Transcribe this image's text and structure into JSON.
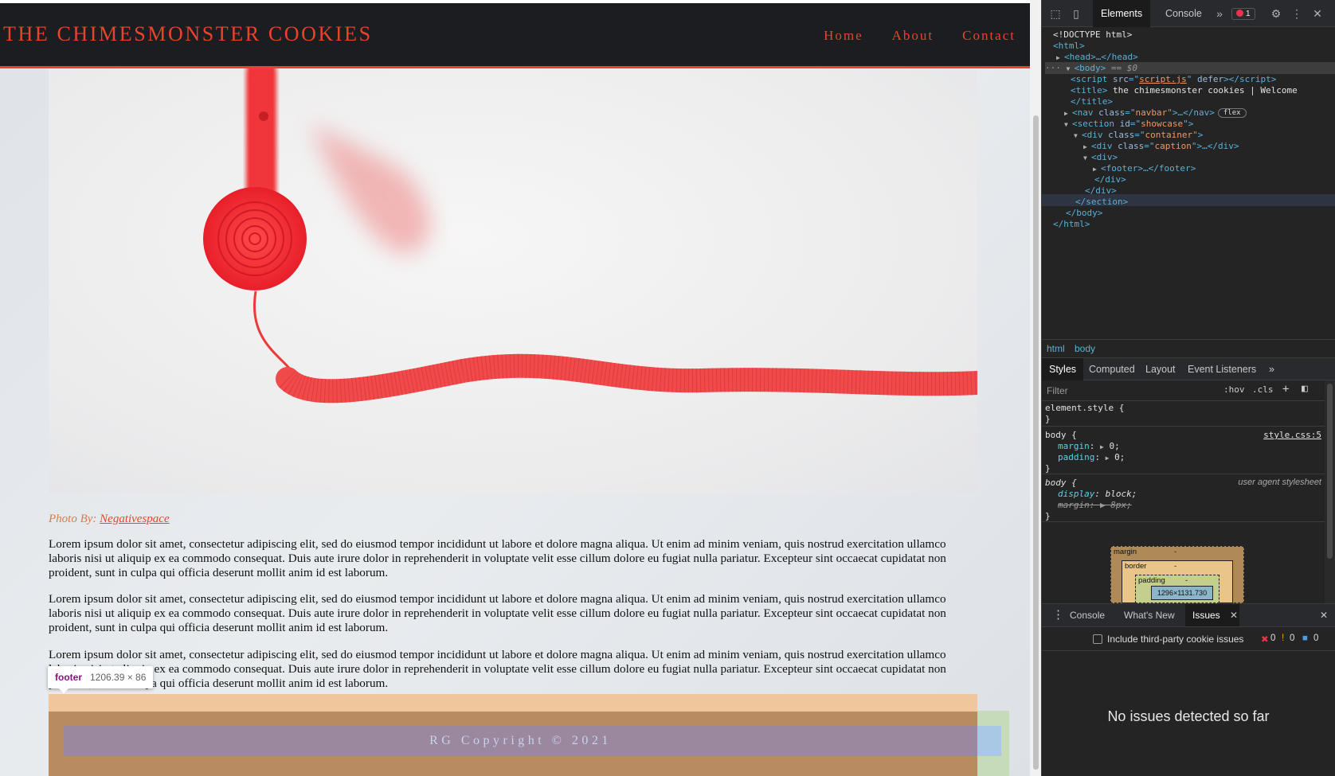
{
  "page": {
    "brand": "THE CHIMESMONSTER COOKIES",
    "nav": [
      "Home",
      "About",
      "Contact"
    ],
    "photo_caption_prefix": "Photo By: ",
    "photo_credit": "Negativespace",
    "paragraphs": [
      "Lorem ipsum dolor sit amet, consectetur adipiscing elit, sed do eiusmod tempor incididunt ut labore et dolore magna aliqua. Ut enim ad minim veniam, quis nostrud exercitation ullamco laboris nisi ut aliquip ex ea commodo consequat. Duis aute irure dolor in reprehenderit in voluptate velit esse cillum dolore eu fugiat nulla pariatur. Excepteur sint occaecat cupidatat non proident, sunt in culpa qui officia deserunt mollit anim id est laborum.",
      "Lorem ipsum dolor sit amet, consectetur adipiscing elit, sed do eiusmod tempor incididunt ut labore et dolore magna aliqua. Ut enim ad minim veniam, quis nostrud exercitation ullamco laboris nisi ut aliquip ex ea commodo consequat. Duis aute irure dolor in reprehenderit in voluptate velit esse cillum dolore eu fugiat nulla pariatur. Excepteur sint occaecat cupidatat non proident, sunt in culpa qui officia deserunt mollit anim id est laborum.",
      "Lorem ipsum dolor sit amet, consectetur adipiscing elit, sed do eiusmod tempor incididunt ut labore et dolore magna aliqua. Ut enim ad minim veniam, quis nostrud exercitation ullamco laboris nisi ut aliquip ex ea commodo consequat. Duis aute irure dolor in reprehenderit in voluptate velit esse cillum dolore eu fugiat nulla pariatur. Excepteur sint occaecat cupidatat non proident, sunt in culpa qui officia deserunt mollit anim id est laborum."
    ],
    "footer_text": "RG Copyright © 2021",
    "inspect_tooltip": {
      "tag": "footer",
      "size": "1206.39 × 86"
    },
    "colors": {
      "accent": "#e8442a",
      "navbar_bg": "#1c1d21"
    }
  },
  "devtools": {
    "tabs": [
      "Elements",
      "Console"
    ],
    "active_tab": "Elements",
    "more_tabs_icon": "double-chevron-icon",
    "error_count": "1",
    "dom": {
      "doctype": "<!DOCTYPE html>",
      "html_open": "<html>",
      "head": "<head>…</head>",
      "body_open": "<body>",
      "body_marker": "== $0",
      "script_tag": "script",
      "script_src_attr": "src",
      "script_src": "script.js",
      "script_defer": "defer",
      "title_text": "the chimesmonster cookies | Welcome",
      "nav_class": "navbar",
      "flex_badge": "flex",
      "section_id": "showcase",
      "container_class": "container",
      "caption_class": "caption",
      "footer": "<footer>…</footer>",
      "div_close": "</div>",
      "section_close": "</section>",
      "body_close": "</body>",
      "html_close": "</html>"
    },
    "breadcrumbs": [
      "html",
      "body"
    ],
    "styles_tabs": [
      "Styles",
      "Computed",
      "Layout",
      "Event Listeners"
    ],
    "filter_placeholder": "Filter",
    "hov": ":hov",
    "cls": ".cls",
    "rules": {
      "element_style": "element.style {",
      "close": "}",
      "body_rule_selector": "body {",
      "body_rule_source": "style.css:5",
      "margin_prop": "margin",
      "margin_val": "0;",
      "padding_prop": "padding",
      "padding_val": "0;",
      "ua_selector": "body {",
      "ua_source": "user agent stylesheet",
      "display_prop": "display",
      "display_val": "block;",
      "ua_margin_prop": "margin",
      "ua_margin_val": "8px;"
    },
    "box_model": {
      "margin_label": "margin",
      "border_label": "border",
      "padding_label": "padding",
      "dash": "-",
      "content_size": "1296×1131.730"
    },
    "drawer": {
      "tabs": [
        "Console",
        "What's New",
        "Issues"
      ],
      "active": "Issues",
      "include_third_party": "Include third-party cookie issues",
      "counts": {
        "errors": "0",
        "warnings": "0",
        "info": "0"
      },
      "empty_message": "No issues detected so far"
    }
  }
}
